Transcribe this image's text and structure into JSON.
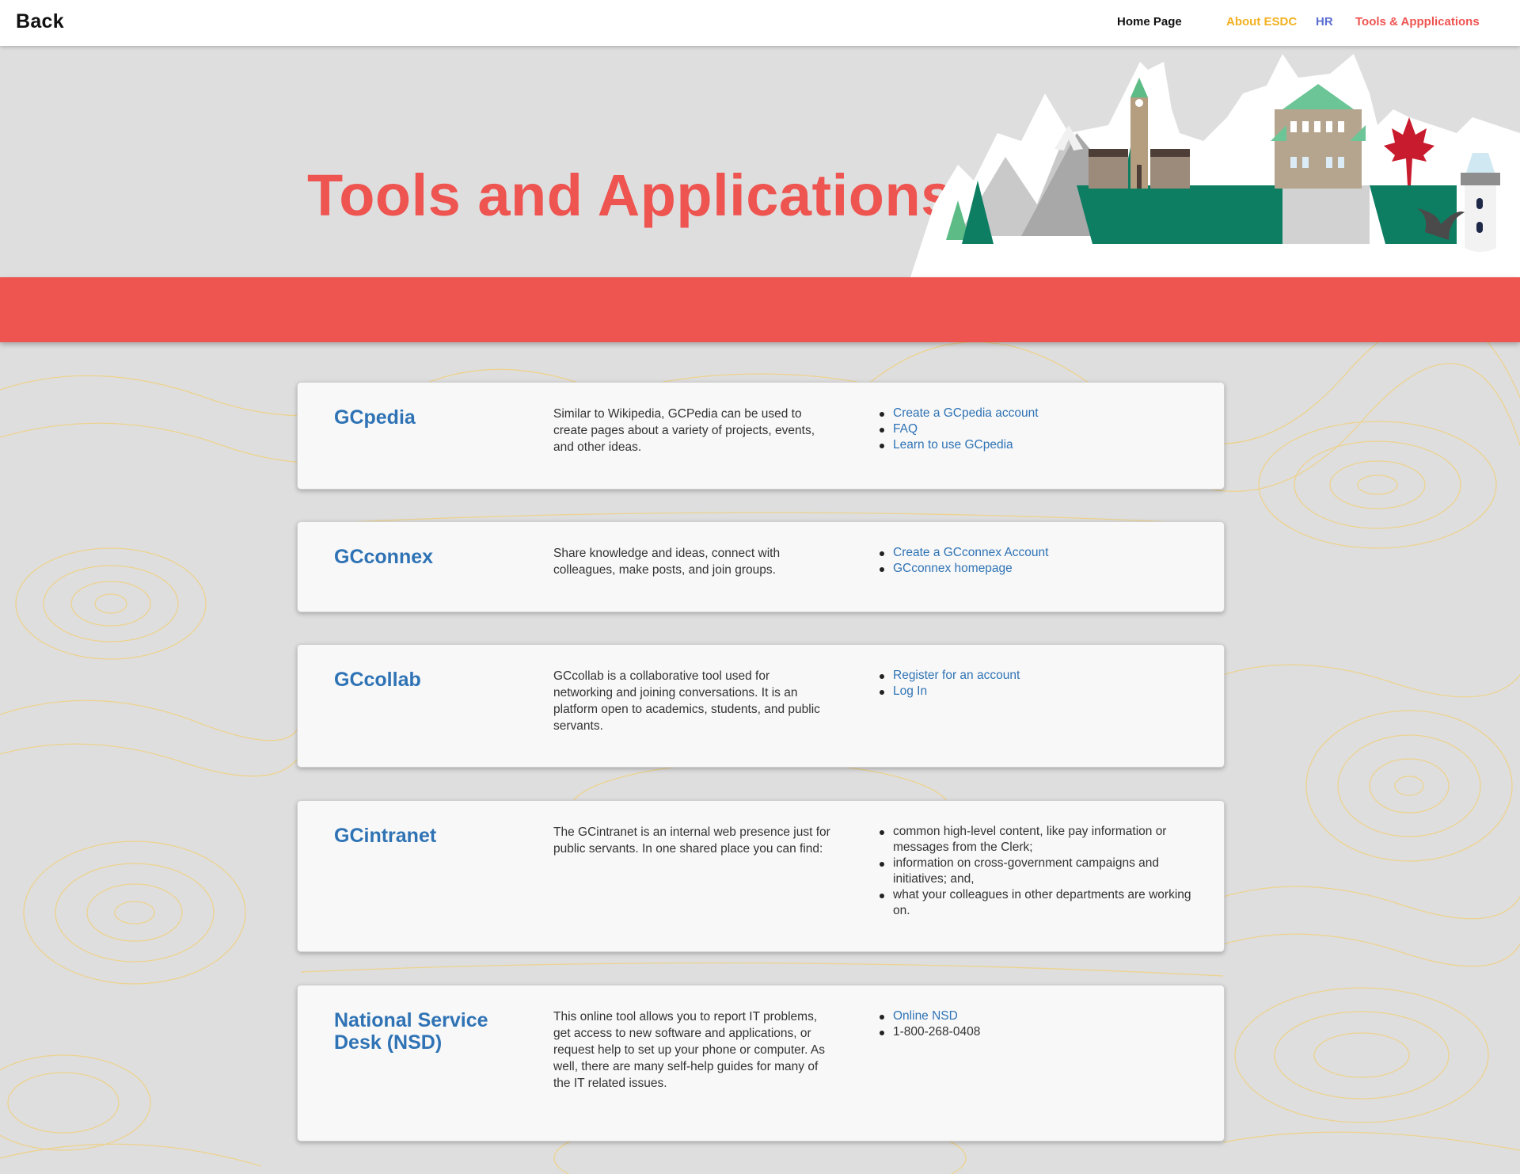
{
  "topbar": {
    "back_label": "Back",
    "nav": {
      "home": "Home Page",
      "about": "About ESDC",
      "hr": "HR",
      "tools": "Tools & Appplications"
    }
  },
  "hero": {
    "title": "Tools and Applications"
  },
  "colors": {
    "accent_red": "#ee5450",
    "link_blue": "#2f73b5",
    "about_yellow": "#f2b01e",
    "hr_blue": "#5b6fd1",
    "background_gray": "#dedede"
  },
  "cards": [
    {
      "title": "GCpedia",
      "description": "Similar to Wikipedia, GCPedia can be used to create pages about a variety of projects, events, and other ideas.",
      "links": [
        "Create a GCpedia account",
        "FAQ",
        "Learn to use GCpedia"
      ]
    },
    {
      "title": "GCconnex",
      "description": "Share knowledge and ideas, connect with colleagues, make posts, and join groups.",
      "links": [
        "Create a GCconnex Account",
        "GCconnex homepage"
      ]
    },
    {
      "title": "GCcollab",
      "description": "GCcollab is a collaborative tool used for networking and joining conversations. It is an platform open to academics, students, and public servants.",
      "links": [
        "Register for an account",
        "Log In"
      ]
    },
    {
      "title": "GCintranet",
      "description": "The GCintranet is an internal web presence just for public servants. In one shared place you can find:",
      "items": [
        "common high-level content, like pay information or messages from the Clerk;",
        "information on cross-government campaigns and initiatives; and,",
        "what your colleagues in other departments are working on."
      ]
    },
    {
      "title": "National Service Desk (NSD)",
      "description": "This online tool allows you to report IT problems, get access to new software and applications, or request help to set up your phone or computer. As well, there are many self-help guides for many of the IT related issues.",
      "links": [
        "Online NSD"
      ],
      "items": [
        "1-800-268-0408"
      ]
    }
  ]
}
